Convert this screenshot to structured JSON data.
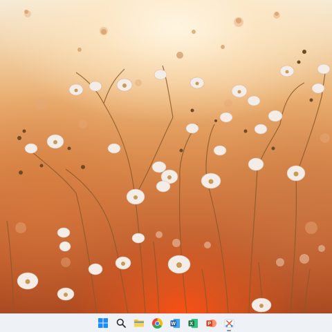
{
  "desktop": {
    "wallpaper": "orange-sunset-wildflowers-photo"
  },
  "taskbar": {
    "background": "#eef1f5",
    "items": [
      {
        "name": "start-button",
        "icon": "windows-logo-icon",
        "color": "#1a8cff"
      },
      {
        "name": "search-button",
        "icon": "search-icon",
        "color": "#2b2b2b"
      },
      {
        "name": "file-explorer-button",
        "icon": "folder-icon",
        "color": "#f2c230"
      },
      {
        "name": "chrome-button",
        "icon": "chrome-icon",
        "color": "#34a853"
      },
      {
        "name": "word-button",
        "icon": "word-icon",
        "color": "#2b5797",
        "glyph": "W"
      },
      {
        "name": "excel-button",
        "icon": "excel-icon",
        "color": "#1f7244",
        "glyph": "X"
      },
      {
        "name": "powerpoint-button",
        "icon": "powerpoint-icon",
        "color": "#d04423",
        "glyph": "P"
      },
      {
        "name": "snipping-tool-button",
        "icon": "snipping-tool-icon",
        "color": "#e05a3a"
      }
    ]
  }
}
